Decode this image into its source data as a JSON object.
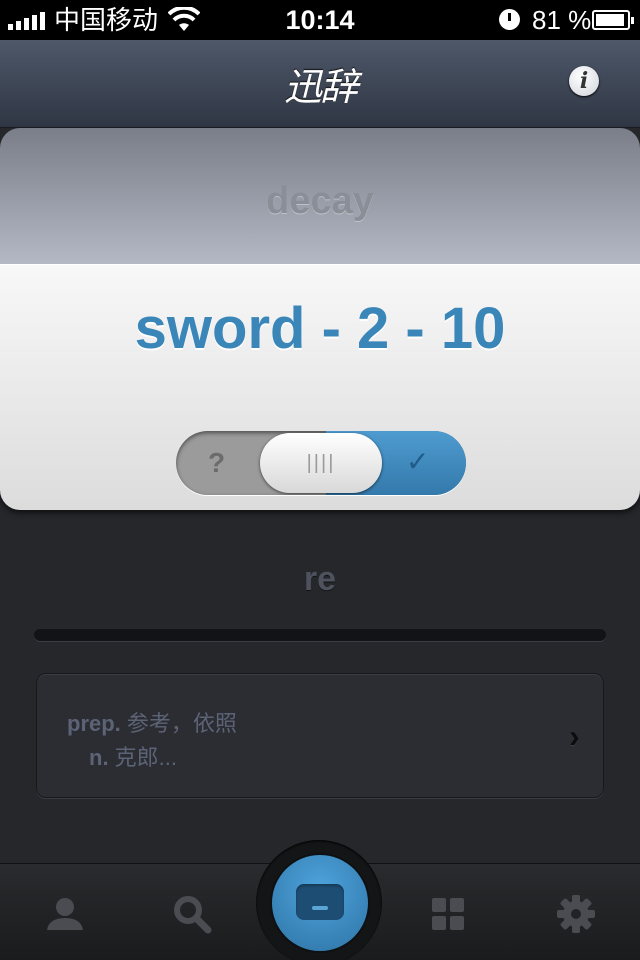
{
  "status_bar": {
    "carrier": "中国移动",
    "time": "10:14",
    "battery_percent": "81 %"
  },
  "nav": {
    "title": "迅辞",
    "info_label": "i"
  },
  "card": {
    "previous_word": "decay",
    "current_word": "sword - 2 - 10",
    "toggle": {
      "left_label": "?",
      "knob_label": "||||",
      "right_label": "✓"
    }
  },
  "root_word": "re",
  "progress": 0,
  "definition": {
    "line1_pos": "prep.",
    "line1_text": " 参考，依照",
    "line2_pos": "n.",
    "line2_text": " 克郎...",
    "arrow": "›"
  },
  "tabbar": {
    "items": [
      "profile-icon",
      "search-icon",
      "flashcard-icon",
      "grid-icon",
      "gear-icon"
    ]
  },
  "colors": {
    "accent": "#3b86b8",
    "card_top": "#a0a4ae",
    "background": "#25272b"
  }
}
